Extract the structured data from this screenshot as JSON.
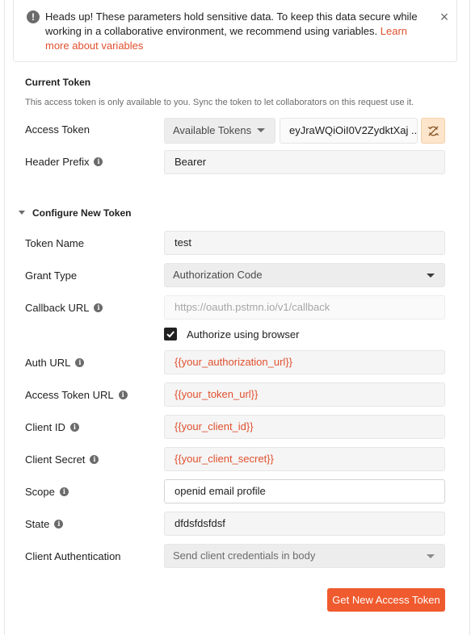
{
  "alert": {
    "message": "Heads up! These parameters hold sensitive data. To keep this data secure while working in a collaborative environment, we recommend using variables.",
    "link_text": "Learn more about variables",
    "close_symbol": "×"
  },
  "current_token": {
    "title": "Current Token",
    "hint": "This access token is only available to you. Sync the token to let collaborators on this request use it.",
    "access_token_label": "Access Token",
    "token_select_value": "Available Tokens",
    "token_value": "eyJraWQiOiI0V2ZydktXaj ...",
    "sync_icon": "sync-off-icon",
    "header_prefix_label": "Header Prefix",
    "header_prefix_value": "Bearer"
  },
  "configure": {
    "title": "Configure New Token",
    "token_name_label": "Token Name",
    "token_name_value": "test",
    "grant_type_label": "Grant Type",
    "grant_type_value": "Authorization Code",
    "callback_url_label": "Callback URL",
    "callback_url_placeholder": "https://oauth.pstmn.io/v1/callback",
    "authorize_browser_label": "Authorize using browser",
    "authorize_browser_checked": true,
    "auth_url_label": "Auth URL",
    "auth_url_value": "{{your_authorization_url}}",
    "access_token_url_label": "Access Token URL",
    "access_token_url_value": "{{your_token_url}}",
    "client_id_label": "Client ID",
    "client_id_value": "{{your_client_id}}",
    "client_secret_label": "Client Secret",
    "client_secret_value": "{{your_client_secret}}",
    "scope_label": "Scope",
    "scope_value": "openid email profile",
    "state_label": "State",
    "state_value": "dfdsfdsfdsf",
    "client_auth_label": "Client Authentication",
    "client_auth_value": "Send client credentials in body",
    "submit_label": "Get New Access Token"
  },
  "colors": {
    "accent": "#ef5a2e",
    "variable_text": "#e0502e",
    "sync_button_bg": "#fde5cc"
  }
}
